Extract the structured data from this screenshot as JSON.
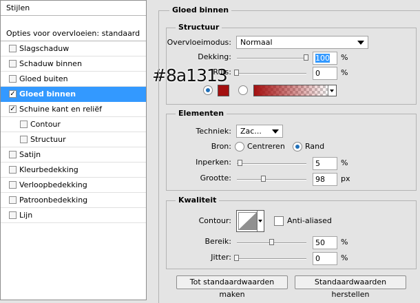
{
  "sidebar": {
    "header": "Stijlen",
    "blending": "Opties voor overvloeien: standaard",
    "items": [
      {
        "label": "Slagschaduw",
        "checked": false,
        "sub": false,
        "selected": false
      },
      {
        "label": "Schaduw binnen",
        "checked": false,
        "sub": false,
        "selected": false
      },
      {
        "label": "Gloed buiten",
        "checked": false,
        "sub": false,
        "selected": false
      },
      {
        "label": "Gloed binnen",
        "checked": true,
        "sub": false,
        "selected": true
      },
      {
        "label": "Schuine kant en reliëf",
        "checked": true,
        "sub": false,
        "selected": false
      },
      {
        "label": "Contour",
        "checked": false,
        "sub": true,
        "selected": false
      },
      {
        "label": "Structuur",
        "checked": false,
        "sub": true,
        "selected": false
      },
      {
        "label": "Satijn",
        "checked": false,
        "sub": false,
        "selected": false
      },
      {
        "label": "Kleurbedekking",
        "checked": false,
        "sub": false,
        "selected": false
      },
      {
        "label": "Verloopbedekking",
        "checked": false,
        "sub": false,
        "selected": false
      },
      {
        "label": "Patroonbedekking",
        "checked": false,
        "sub": false,
        "selected": false
      },
      {
        "label": "Lijn",
        "checked": false,
        "sub": false,
        "selected": false
      }
    ]
  },
  "overlay_text": "#8a1313",
  "panel": {
    "title": "Gloed binnen",
    "structure": {
      "title": "Structuur",
      "blend_label": "Overvloeimodus:",
      "blend_value": "Normaal",
      "opacity_label": "Dekking:",
      "opacity_value": "100",
      "opacity_level": 100,
      "noise_label": "Ruis:",
      "noise_value": "0",
      "noise_level": 0,
      "percent": "%",
      "color": "#a31010"
    },
    "elements": {
      "title": "Elementen",
      "technique_label": "Techniek:",
      "technique_value": "Zac...",
      "source_label": "Bron:",
      "source_center": "Centreren",
      "source_edge": "Rand",
      "choke_label": "Inperken:",
      "choke_value": "5",
      "choke_level": 5,
      "size_label": "Grootte:",
      "size_value": "98",
      "size_level": 39,
      "percent": "%",
      "px": "px"
    },
    "quality": {
      "title": "Kwaliteit",
      "contour_label": "Contour:",
      "antialias_label": "Anti-aliased",
      "range_label": "Bereik:",
      "range_value": "50",
      "range_level": 50,
      "jitter_label": "Jitter:",
      "jitter_value": "0",
      "jitter_level": 0,
      "percent": "%"
    },
    "buttons": {
      "make_default": "Tot standaardwaarden maken",
      "reset_default": "Standaardwaarden herstellen"
    }
  }
}
